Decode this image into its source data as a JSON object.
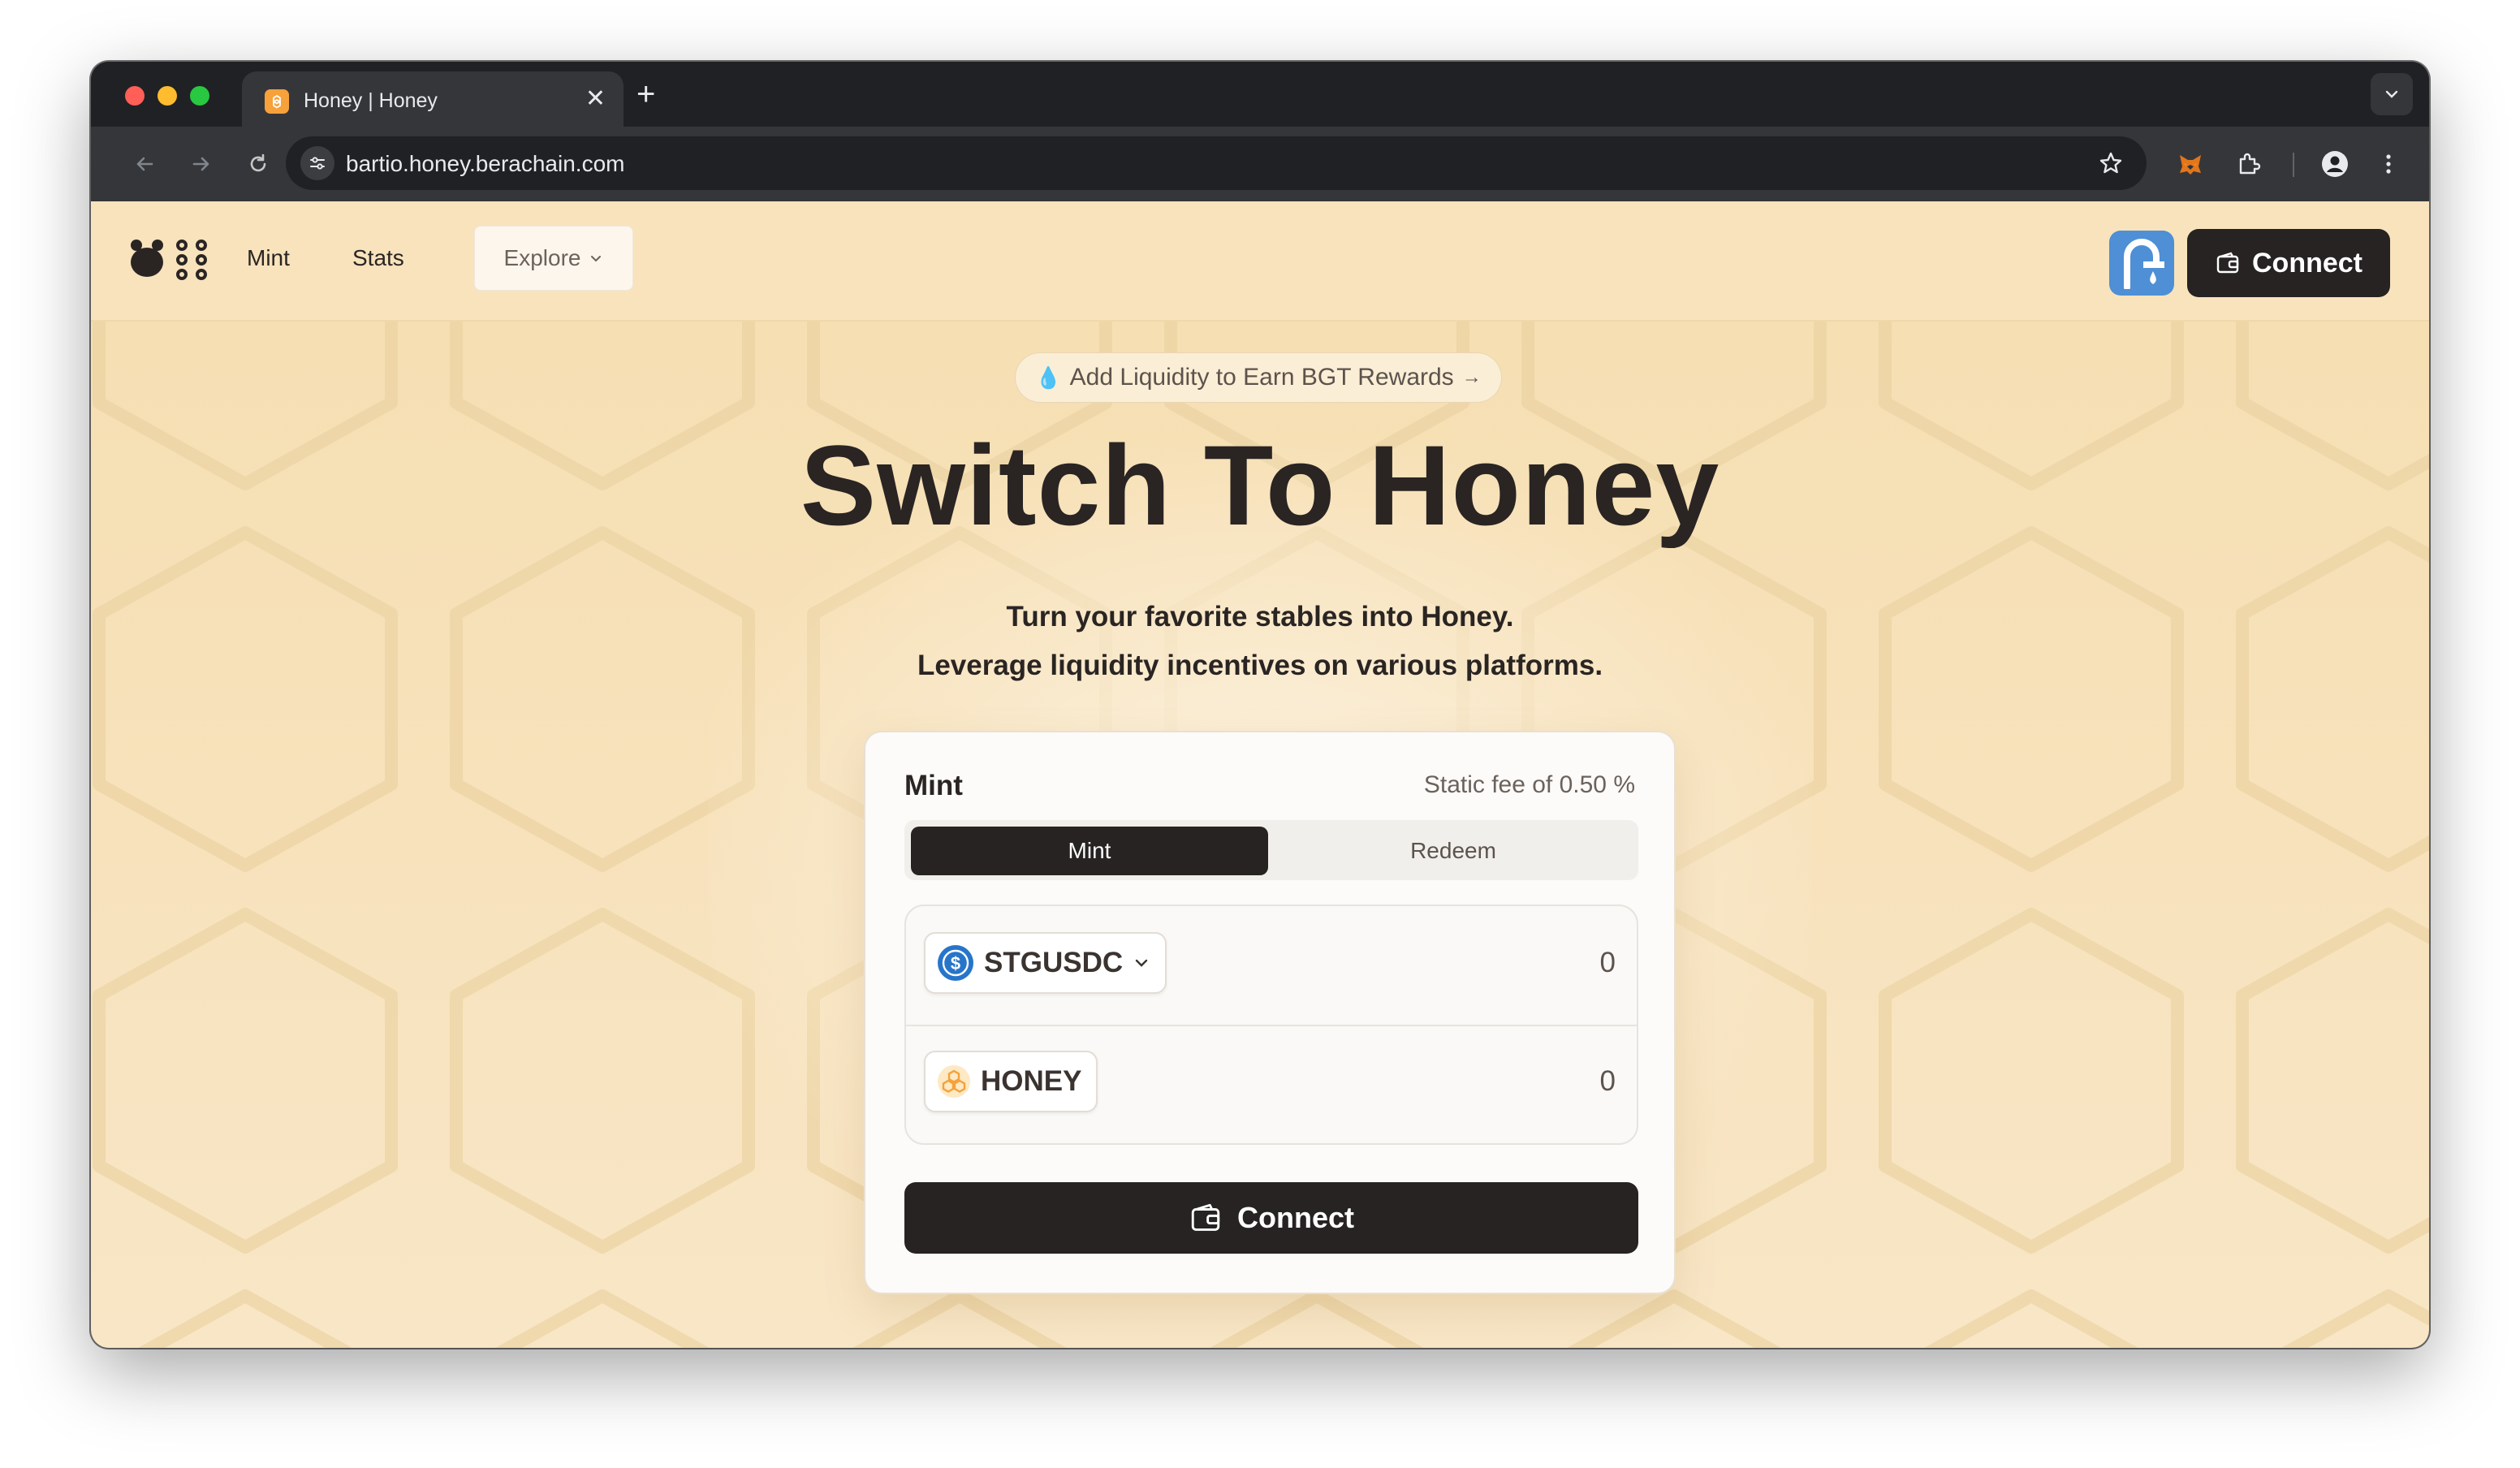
{
  "browser": {
    "tab_title": "Honey | Honey",
    "tab_close_glyph": "✕",
    "new_tab_glyph": "+",
    "url": "bartio.honey.berachain.com",
    "icons": [
      "back-icon",
      "forward-icon",
      "reload-icon",
      "site-settings-icon",
      "bookmark-star-icon",
      "metamask-fox-icon",
      "extensions-puzzle-icon",
      "profile-icon",
      "more-vert-icon",
      "tab-search-chevron-icon"
    ]
  },
  "nav": {
    "links": [
      "Mint",
      "Stats"
    ],
    "explore_label": "Explore",
    "connect_label": "Connect"
  },
  "promo": {
    "emoji": "💧",
    "text": "Add Liquidity to Earn BGT Rewards",
    "arrow": "→"
  },
  "hero": {
    "title": "Switch To Honey",
    "subtitle_1": "Turn your favorite stables into Honey.",
    "subtitle_2": "Leverage liquidity incentives on various platforms."
  },
  "card": {
    "title": "Mint",
    "fee": "Static fee of 0.50 %",
    "tabs": [
      "Mint",
      "Redeem"
    ],
    "active_tab": "Mint",
    "from_token": {
      "symbol": "STGUSDC",
      "amount": "0"
    },
    "to_token": {
      "symbol": "HONEY",
      "amount": "0"
    },
    "connect_label": "Connect"
  },
  "colors": {
    "page_bg": "#f6deb0",
    "dark": "#262322",
    "faucet_blue": "#4e8fd6",
    "usdc_blue": "#2775ca",
    "honey_orange": "#f6a13a"
  }
}
